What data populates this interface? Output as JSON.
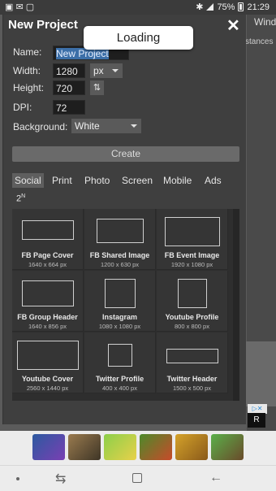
{
  "status_bar": {
    "battery": "75%",
    "time": "21:29"
  },
  "background_app": {
    "window_menu": "Wind",
    "instances_fragment": "stances",
    "ad_side_letter": "R"
  },
  "dialog": {
    "title": "New Project",
    "loading_text": "Loading",
    "name_label": "Name:",
    "name_value": "New Project",
    "width_label": "Width:",
    "width_value": "1280",
    "unit_value": "px",
    "height_label": "Height:",
    "height_value": "720",
    "dpi_label": "DPI:",
    "dpi_value": "72",
    "background_label": "Background:",
    "background_value": "White",
    "create_label": "Create",
    "tabs": [
      {
        "label": "Social",
        "active": true
      },
      {
        "label": "Print",
        "active": false
      },
      {
        "label": "Photo",
        "active": false
      },
      {
        "label": "Screen",
        "active": false
      },
      {
        "label": "Mobile",
        "active": false
      },
      {
        "label": "Ads",
        "active": false
      }
    ],
    "tab_2n": "2",
    "tab_2n_sup": "N",
    "templates": [
      {
        "name": "FB Page Cover",
        "size": "1640 x 664 px"
      },
      {
        "name": "FB Shared Image",
        "size": "1200 x 630 px"
      },
      {
        "name": "FB Event Image",
        "size": "1920 x 1080 px"
      },
      {
        "name": "FB Group Header",
        "size": "1640 x 856 px"
      },
      {
        "name": "Instagram",
        "size": "1080 x 1080 px"
      },
      {
        "name": "Youtube Profile",
        "size": "800 x 800 px"
      },
      {
        "name": "Youtube Cover",
        "size": "2560 x 1440 px"
      },
      {
        "name": "Twitter Profile",
        "size": "400 x 400 px"
      },
      {
        "name": "Twitter Header",
        "size": "1500 x 500 px"
      }
    ]
  },
  "colors": {
    "dialog_bg": "#3f3f3f",
    "selection": "#3c6fa8",
    "ad_bar": "#ececec"
  },
  "icons": {
    "close": "close-icon",
    "swap": "swap-icon",
    "back": "back-icon",
    "recents": "recents-icon",
    "home": "home-icon"
  }
}
